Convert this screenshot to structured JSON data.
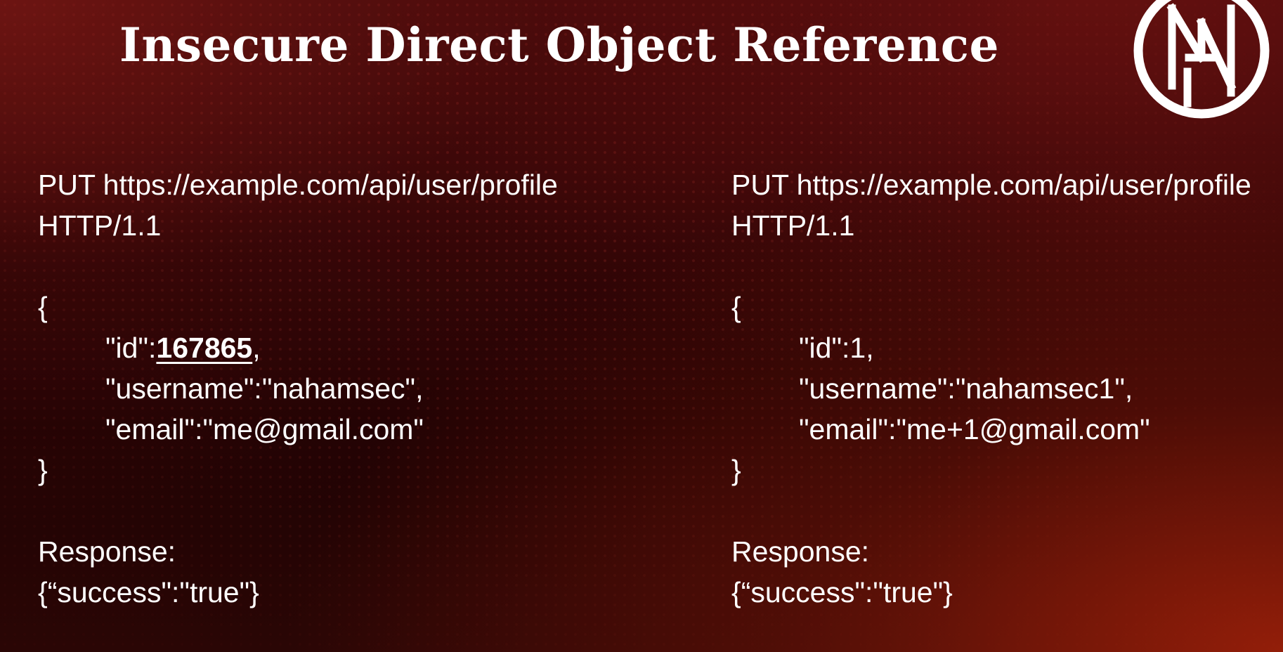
{
  "slide": {
    "title": "Insecure Direct Object Reference"
  },
  "colors": {
    "background_dark": "#1f0203",
    "background_accent": "#a5220a",
    "text": "#ffffff"
  },
  "logo": {
    "icon": "nm-monogram-circle-icon"
  },
  "requests": [
    {
      "request_line": "PUT https://example.com/api/user/profile",
      "protocol": "HTTP/1.1",
      "open_brace": "{",
      "id_key": "\"id\":",
      "id_value": "167865",
      "id_comma": ",",
      "username_line": "\"username\":\"nahamsec\",",
      "email_line": "\"email\":\"me@gmail.com\"",
      "close_brace": "}",
      "response_label": "Response:",
      "response_body": "{“success\":\"true\"}"
    },
    {
      "request_line": "PUT https://example.com/api/user/profile",
      "protocol": "HTTP/1.1",
      "open_brace": "{",
      "id_key": "\"id\":",
      "id_value": "1",
      "id_comma": ",",
      "username_line": "\"username\":\"nahamsec1\",",
      "email_line": "\"email\":\"me+1@gmail.com\"",
      "close_brace": "}",
      "response_label": "Response:",
      "response_body": "{“success\":\"true\"}"
    }
  ]
}
